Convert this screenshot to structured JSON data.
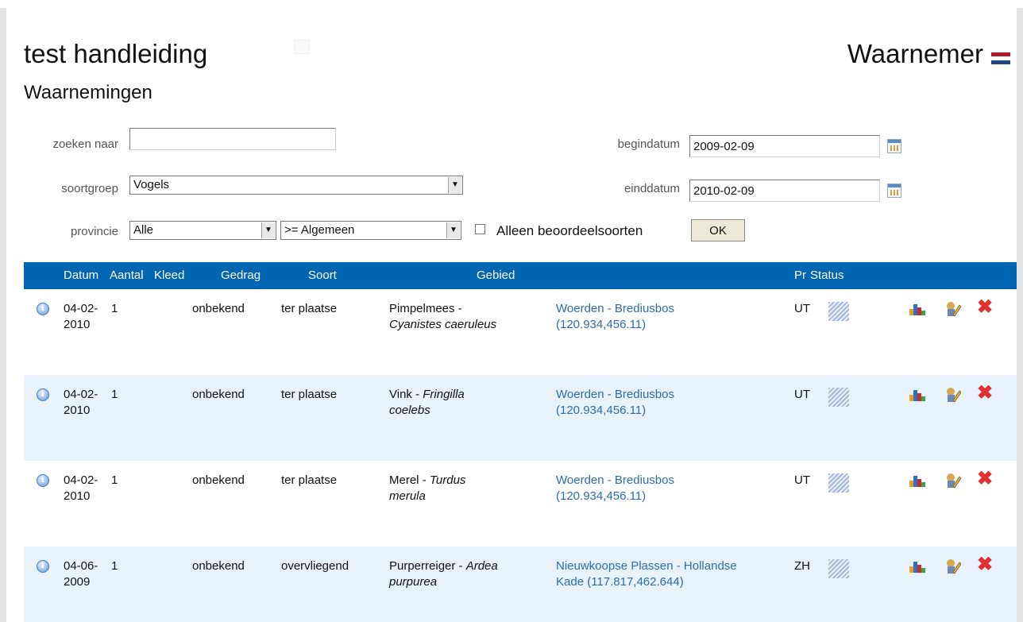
{
  "site": {
    "title": "test handleiding",
    "role": "Waarnemer",
    "flag_colors": [
      "#ae1c28",
      "#ffffff",
      "#21468b"
    ]
  },
  "page": {
    "title": "Waarnemingen"
  },
  "filters": {
    "search_label": "zoeken naar",
    "search_value": "",
    "soortgroep_label": "soortgroep",
    "soortgroep_value": "Vogels",
    "provincie_label": "provincie",
    "provincie_value": "Alle",
    "zeldzaamheid_value": ">= Algemeen",
    "checkbox_label": "Alleen beoordeelsoorten",
    "checkbox_checked": false,
    "ok_label": "OK",
    "begindatum_label": "begindatum",
    "begindatum_value": "2009-02-09",
    "einddatum_label": "einddatum",
    "einddatum_value": "2010-02-09"
  },
  "table": {
    "header_color": "#0066b3",
    "alt_row_color": "#e8f2fb",
    "columns": [
      "Datum",
      "Aantal",
      "Kleed",
      "Gedrag",
      "Soort",
      "Gebied",
      "Pr",
      "Status"
    ],
    "rows": [
      {
        "date_line1": "04-02-",
        "date_line2": "2010",
        "aantal": "1",
        "kleed": "onbekend",
        "gedrag": "ter plaatse",
        "soort_nl": "Pimpelmees - ",
        "soort_sci": "Cyanistes caeruleus",
        "gebied": "Woerden - Brediusbos (120.934,456.11)",
        "provincie": "UT"
      },
      {
        "date_line1": "04-02-",
        "date_line2": "2010",
        "aantal": "1",
        "kleed": "onbekend",
        "gedrag": "ter plaatse",
        "soort_nl": "Vink - ",
        "soort_sci": "Fringilla coelebs",
        "gebied": "Woerden - Brediusbos (120.934,456.11)",
        "provincie": "UT"
      },
      {
        "date_line1": "04-02-",
        "date_line2": "2010",
        "aantal": "1",
        "kleed": "onbekend",
        "gedrag": "ter plaatse",
        "soort_nl": "Merel - ",
        "soort_sci": "Turdus merula",
        "gebied": "Woerden - Brediusbos (120.934,456.11)",
        "provincie": "UT"
      },
      {
        "date_line1": "04-06-",
        "date_line2": "2009",
        "aantal": "1",
        "kleed": "onbekend",
        "gedrag": "overvliegend",
        "soort_nl": "Purperreiger - ",
        "soort_sci": "Ardea purpurea",
        "gebied": "Nieuwkoopse Plassen - Hollandse Kade (117.817,462.644)",
        "provincie": "ZH"
      }
    ]
  },
  "icons": {
    "info": "info-icon",
    "status": "status-pending-icon",
    "chart": "bar-chart-icon",
    "edit": "edit-icon",
    "delete": "delete-icon"
  }
}
